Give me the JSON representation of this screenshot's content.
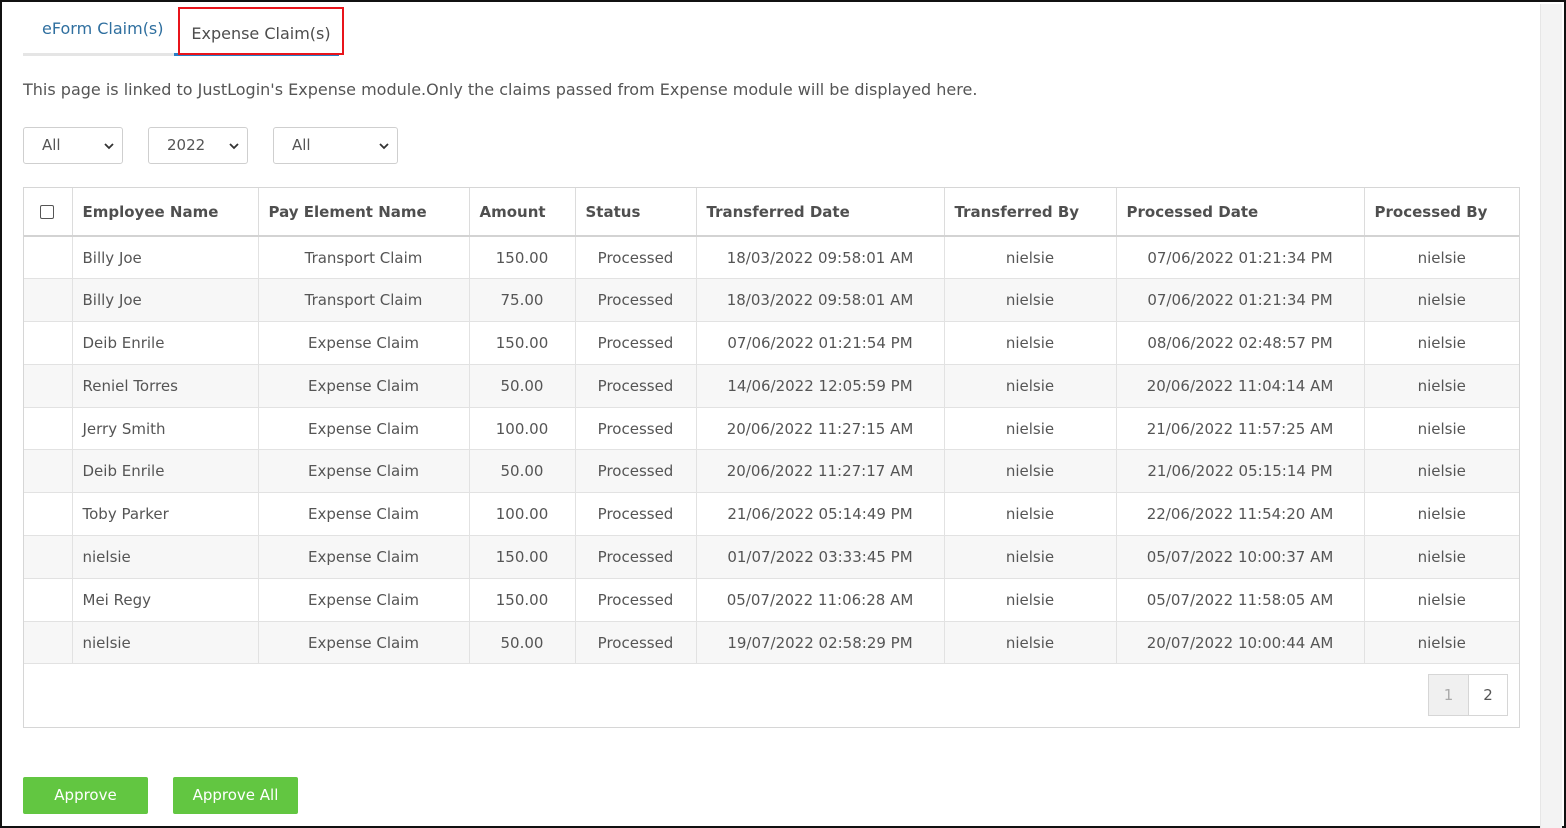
{
  "tabs": [
    {
      "label": "eForm Claim(s)"
    },
    {
      "label": "Expense Claim(s)"
    }
  ],
  "info_text": "This page is linked to JustLogin's Expense module.Only the claims passed from Expense module will be displayed here.",
  "filters": {
    "filter1": "All",
    "filter2": "2022",
    "filter3": "All"
  },
  "table": {
    "headers": [
      "Employee Name",
      "Pay Element Name",
      "Amount",
      "Status",
      "Transferred Date",
      "Transferred By",
      "Processed Date",
      "Processed By"
    ],
    "rows": [
      [
        "Billy Joe",
        "Transport Claim",
        "150.00",
        "Processed",
        "18/03/2022 09:58:01 AM",
        "nielsie",
        "07/06/2022 01:21:34 PM",
        "nielsie"
      ],
      [
        "Billy Joe",
        "Transport Claim",
        "75.00",
        "Processed",
        "18/03/2022 09:58:01 AM",
        "nielsie",
        "07/06/2022 01:21:34 PM",
        "nielsie"
      ],
      [
        "Deib Enrile",
        "Expense Claim",
        "150.00",
        "Processed",
        "07/06/2022 01:21:54 PM",
        "nielsie",
        "08/06/2022 02:48:57 PM",
        "nielsie"
      ],
      [
        "Reniel Torres",
        "Expense Claim",
        "50.00",
        "Processed",
        "14/06/2022 12:05:59 PM",
        "nielsie",
        "20/06/2022 11:04:14 AM",
        "nielsie"
      ],
      [
        "Jerry Smith",
        "Expense Claim",
        "100.00",
        "Processed",
        "20/06/2022 11:27:15 AM",
        "nielsie",
        "21/06/2022 11:57:25 AM",
        "nielsie"
      ],
      [
        "Deib Enrile",
        "Expense Claim",
        "50.00",
        "Processed",
        "20/06/2022 11:27:17 AM",
        "nielsie",
        "21/06/2022 05:15:14 PM",
        "nielsie"
      ],
      [
        "Toby Parker",
        "Expense Claim",
        "100.00",
        "Processed",
        "21/06/2022 05:14:49 PM",
        "nielsie",
        "22/06/2022 11:54:20 AM",
        "nielsie"
      ],
      [
        "nielsie",
        "Expense Claim",
        "150.00",
        "Processed",
        "01/07/2022 03:33:45 PM",
        "nielsie",
        "05/07/2022 10:00:37 AM",
        "nielsie"
      ],
      [
        "Mei Regy",
        "Expense Claim",
        "150.00",
        "Processed",
        "05/07/2022 11:06:28 AM",
        "nielsie",
        "05/07/2022 11:58:05 AM",
        "nielsie"
      ],
      [
        "nielsie",
        "Expense Claim",
        "50.00",
        "Processed",
        "19/07/2022 02:58:29 PM",
        "nielsie",
        "20/07/2022 10:00:44 AM",
        "nielsie"
      ]
    ]
  },
  "pagination": {
    "pages": [
      "1",
      "2"
    ],
    "current": "1"
  },
  "buttons": {
    "approve": "Approve",
    "approve_all": "Approve All"
  },
  "colors": {
    "accent": "#2a7ec5",
    "button": "#62c641",
    "highlight": "#e8141b"
  }
}
